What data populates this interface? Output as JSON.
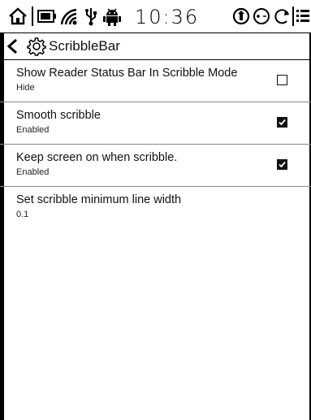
{
  "status_bar": {
    "time": "10:36",
    "icons": [
      "home-icon",
      "battery-icon",
      "wifi-icon",
      "usb-icon",
      "android-icon",
      "rotate-icon",
      "zoom-icon",
      "refresh-icon",
      "menu-icon"
    ]
  },
  "title_bar": {
    "title": "ScribbleBar",
    "icons": [
      "back-arrow-icon",
      "gear-icon"
    ]
  },
  "settings": [
    {
      "title": "Show Reader Status Bar In Scribble Mode",
      "summary": "Hide",
      "checkbox": true,
      "checked": false
    },
    {
      "title": "Smooth scribble",
      "summary": "Enabled",
      "checkbox": true,
      "checked": true
    },
    {
      "title": "Keep screen on when scribble.",
      "summary": "Enabled",
      "checkbox": true,
      "checked": true
    },
    {
      "title": "Set scribble minimum line width",
      "summary": "0.1",
      "checkbox": false
    }
  ]
}
